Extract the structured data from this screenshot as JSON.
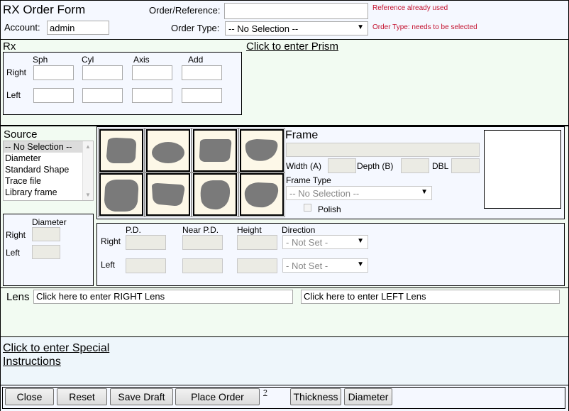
{
  "header": {
    "title": "RX Order Form",
    "account_label": "Account:",
    "account_value": "admin",
    "order_ref_label": "Order/Reference:",
    "order_ref_value": "",
    "order_ref_error": "Reference already used",
    "order_type_label": "Order Type:",
    "order_type_value": "-- No Selection --",
    "order_type_error": "Order Type: needs to be selected"
  },
  "rx": {
    "title": "Rx",
    "columns": [
      "Sph",
      "Cyl",
      "Axis",
      "Add"
    ],
    "row_right": "Right",
    "row_left": "Left",
    "prism_link": "Click to enter Prism"
  },
  "source": {
    "title": "Source",
    "options": [
      "-- No Selection --",
      "Diameter",
      "Standard Shape",
      "Trace file",
      "Library frame"
    ],
    "selected_index": 0
  },
  "diameter": {
    "title": "Diameter",
    "right": "Right",
    "left": "Left"
  },
  "frame": {
    "title": "Frame",
    "width_label": "Width (A)",
    "depth_label": "Depth (B)",
    "dbl_label": "DBL",
    "frame_type_label": "Frame Type",
    "frame_type_value": "-- No Selection --",
    "polish_label": "Polish",
    "shapes": [
      "shape-1",
      "shape-2",
      "shape-3",
      "shape-4",
      "shape-5",
      "shape-6",
      "shape-7",
      "shape-8"
    ]
  },
  "measurements": {
    "pd": "P.D.",
    "near_pd": "Near P.D.",
    "height": "Height",
    "direction": "Direction",
    "right": "Right",
    "left": "Left",
    "direction_right_value": "- Not Set -",
    "direction_left_value": "- Not Set -"
  },
  "lens": {
    "title": "Lens",
    "right_placeholder": "Click here to enter RIGHT Lens",
    "left_placeholder": "Click here to enter LEFT Lens"
  },
  "special": {
    "link_line1": "Click to enter Special",
    "link_line2": "Instructions"
  },
  "footer": {
    "close": "Close",
    "reset": "Reset",
    "save_draft": "Save Draft",
    "place_order": "Place Order",
    "help": "?",
    "thickness": "Thickness",
    "diameter": "Diameter"
  },
  "colors": {
    "section_bg": "#f2fbf2",
    "panel_bg": "#f5f8ff",
    "error_red": "#c4122f",
    "shape_fill": "#7a7a7a",
    "shape_bg": "#fdf8e8"
  }
}
